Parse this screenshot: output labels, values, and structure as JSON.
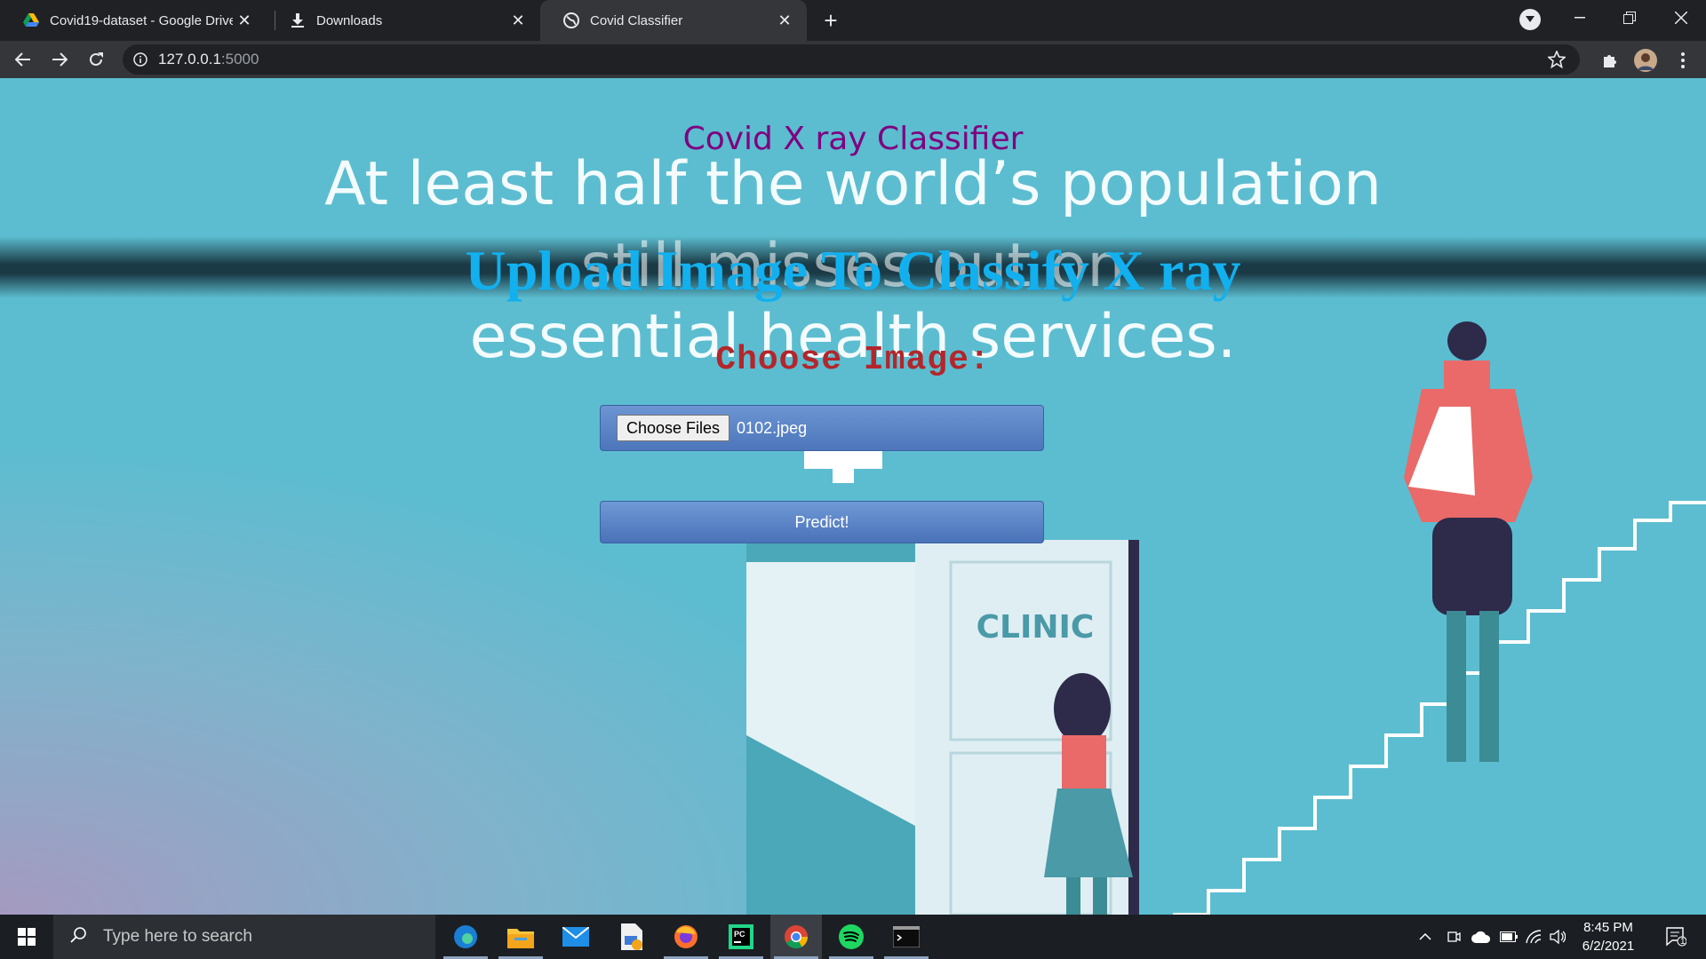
{
  "browser": {
    "tabs": [
      {
        "title": "Covid19-dataset - Google Drive",
        "icon": "google-drive-icon",
        "active": false
      },
      {
        "title": "Downloads",
        "icon": "download-icon",
        "active": false
      },
      {
        "title": "Covid Classifier",
        "icon": "globe-icon",
        "active": true
      }
    ],
    "url_host": "127.0.0.1",
    "url_port": ":5000"
  },
  "page": {
    "site_title": "Covid X ray Classifier",
    "background_text": {
      "line1": "At least half the world’s population",
      "line2": "still misses out on",
      "line3": "essential health services."
    },
    "upload_heading": "Upload Image To Classify X ray",
    "choose_label": "Choose Image:",
    "file_button": "Choose Files",
    "file_name": "0102.jpeg",
    "predict_button": "Predict!",
    "clinic_sign": "CLINIC"
  },
  "taskbar": {
    "search_placeholder": "Type here to search",
    "apps": [
      "edge-icon",
      "file-explorer-icon",
      "mail-icon",
      "file-tool-icon",
      "firefox-icon",
      "pycharm-icon",
      "chrome-icon",
      "spotify-icon",
      "terminal-icon"
    ],
    "time": "8:45 PM",
    "date": "6/2/2021",
    "notification_count": "1"
  },
  "colors": {
    "site_title": "#800080",
    "upload_heading": "#12b0ee",
    "choose_label": "#b3262b",
    "page_background": "#5cbdd0"
  }
}
